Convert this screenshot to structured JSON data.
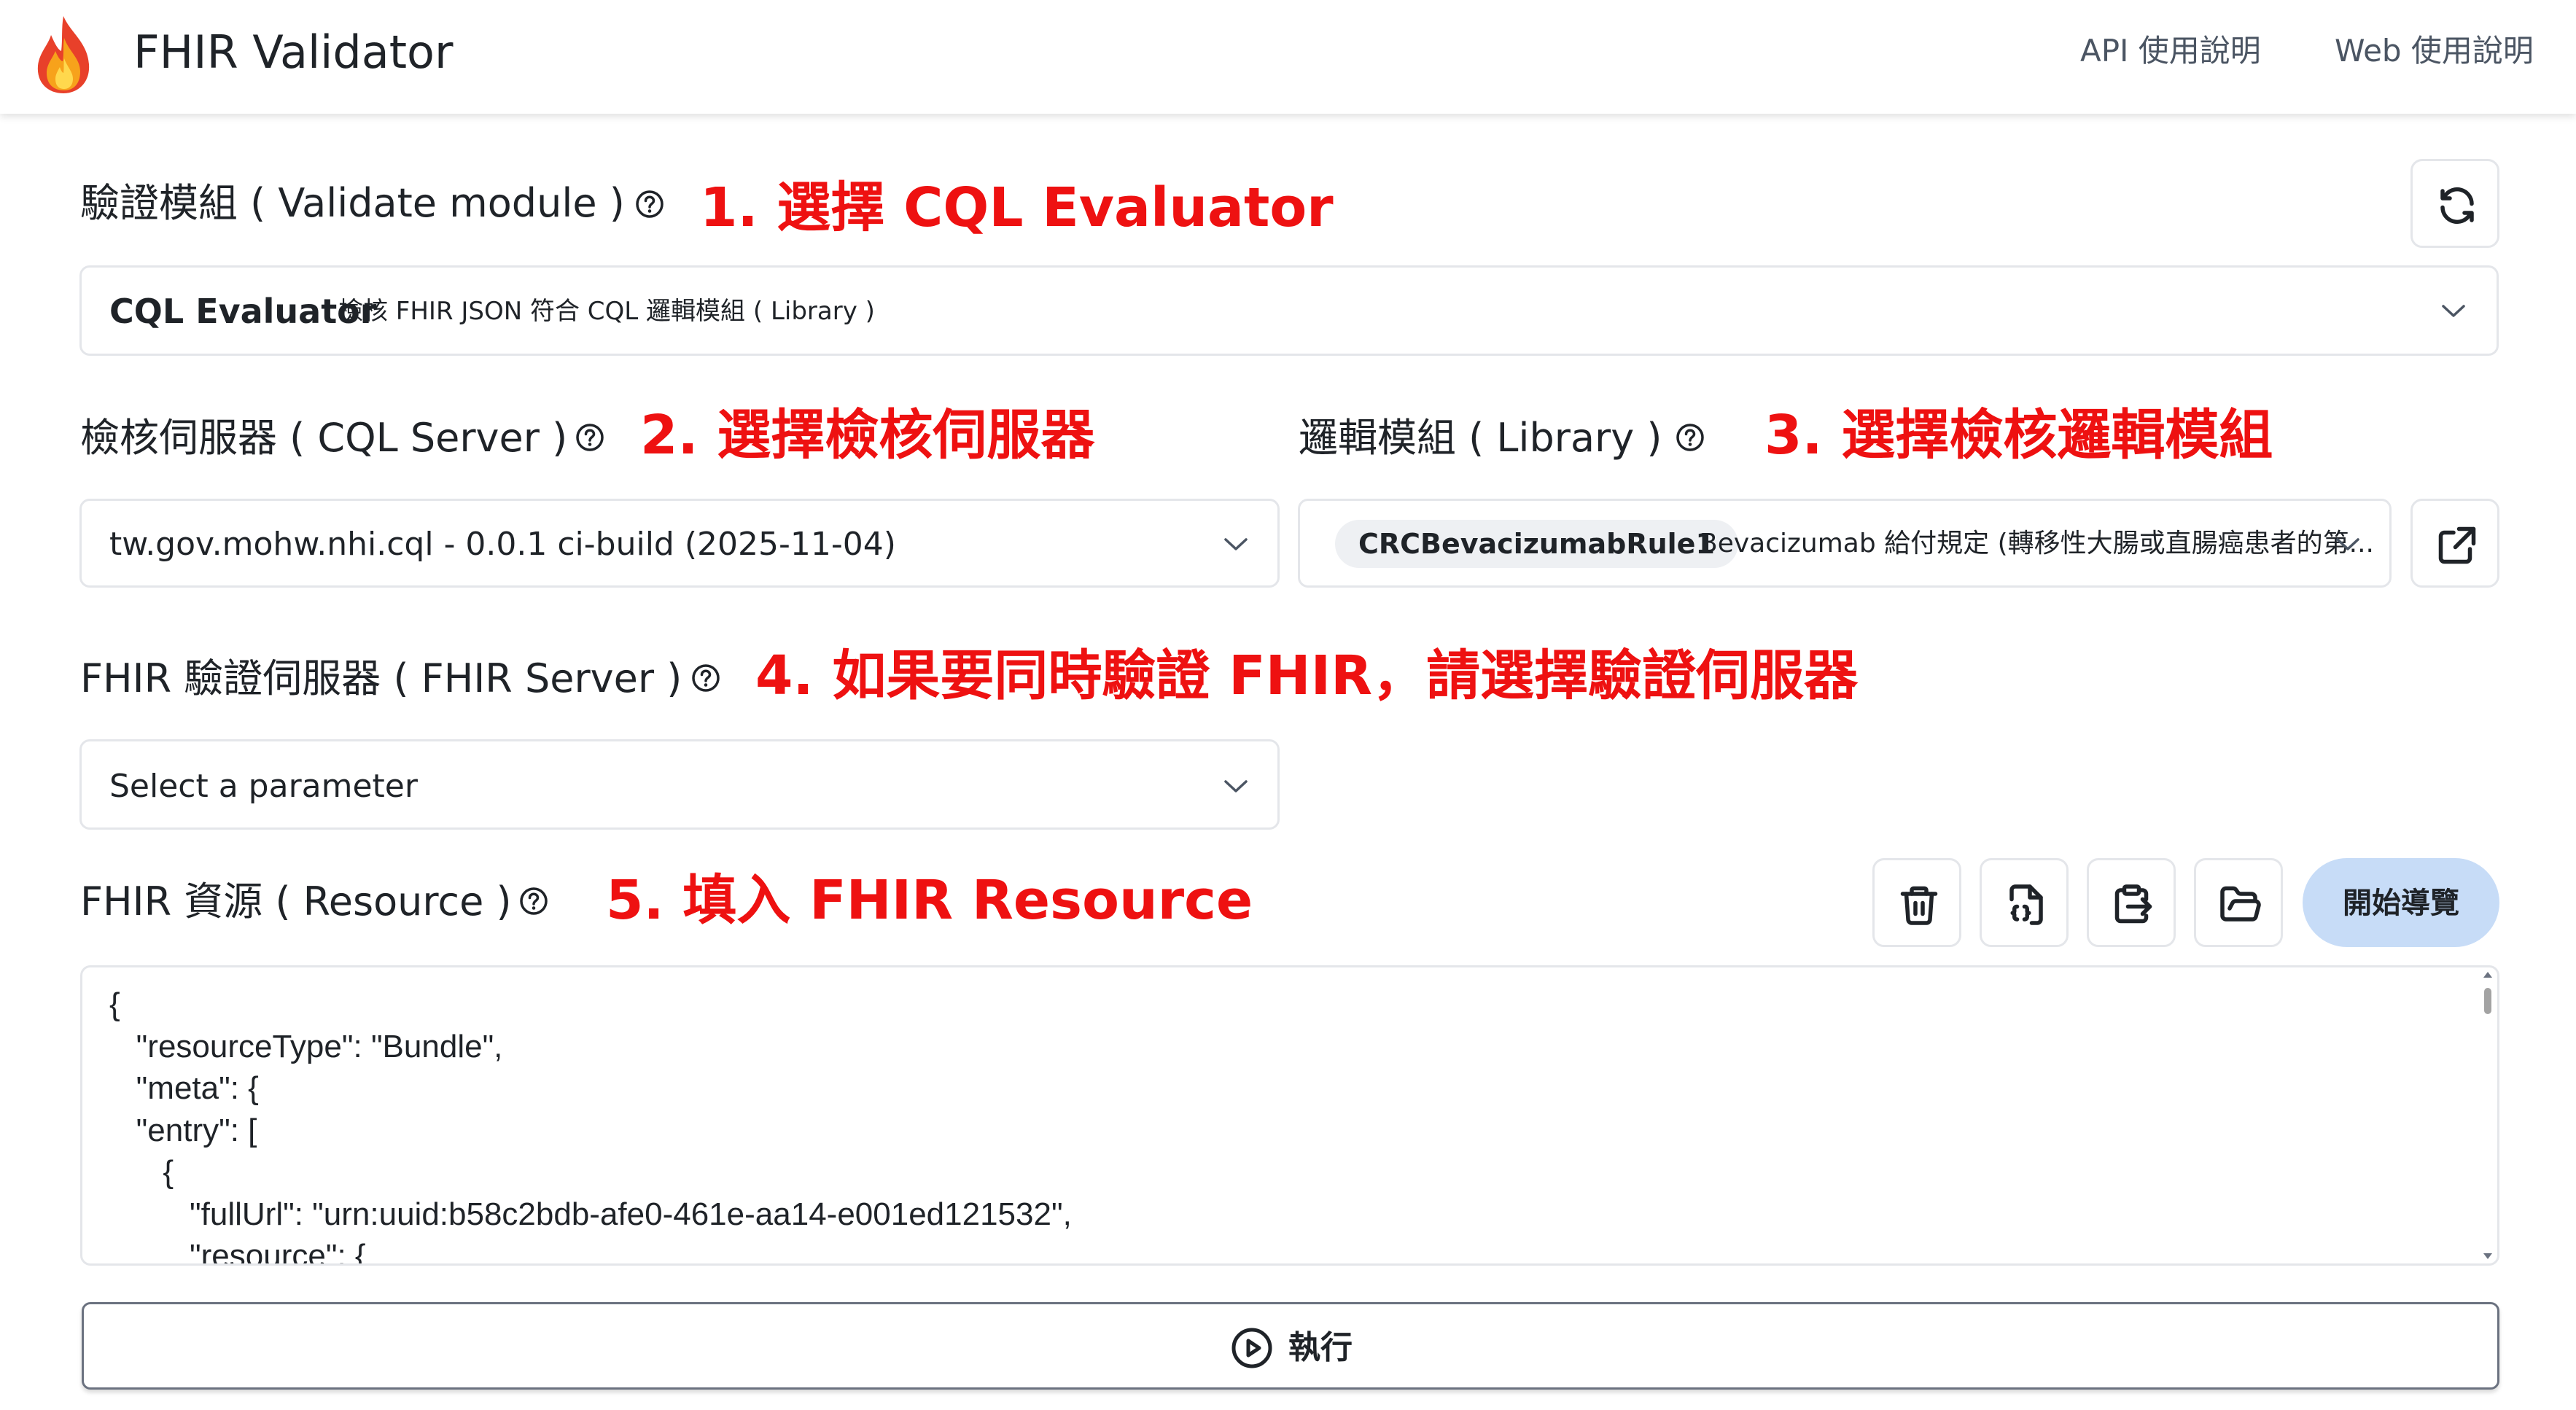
{
  "header": {
    "title": "FHIR Validator",
    "nav": [
      "API 使用說明",
      "Web 使用說明"
    ]
  },
  "module": {
    "label": "驗證模組 ( Validate module )",
    "annotation": "1. 選擇 CQL Evaluator",
    "selected_name": "CQL Evaluator",
    "selected_desc": "檢核 FHIR JSON 符合 CQL 邏輯模組 ( Library )"
  },
  "cql_server": {
    "label": "檢核伺服器 ( CQL Server )",
    "annotation": "2. 選擇檢核伺服器",
    "value": "tw.gov.mohw.nhi.cql - 0.0.1 ci-build (2025-11-04)"
  },
  "library": {
    "label": "邏輯模組 ( Library )",
    "annotation": "3. 選擇檢核邏輯模組",
    "tag": "CRCBevacizumabRule1",
    "value": "Bevacizumab 給付規定 (轉移性大腸或直腸癌患者的第..."
  },
  "fhir_server": {
    "label": "FHIR 驗證伺服器 ( FHIR Server )",
    "annotation": "4. 如果要同時驗證 FHIR，請選擇驗證伺服器",
    "placeholder": "Select a parameter"
  },
  "resource": {
    "label": "FHIR 資源 ( Resource )",
    "annotation": "5. 填入 FHIR Resource",
    "tour_label": "開始導覽",
    "code": "{\n   \"resourceType\": \"Bundle\",\n   \"meta\": {\n   \"entry\": [\n      {\n         \"fullUrl\": \"urn:uuid:b58c2bdb-afe0-461e-aa14-e001ed121532\",\n         \"resource\": {"
  },
  "run": {
    "label": "執行"
  },
  "colors": {
    "annotation": "#ee1111",
    "tour_button": "#c7dcf7",
    "border": "#e4e6ea"
  }
}
